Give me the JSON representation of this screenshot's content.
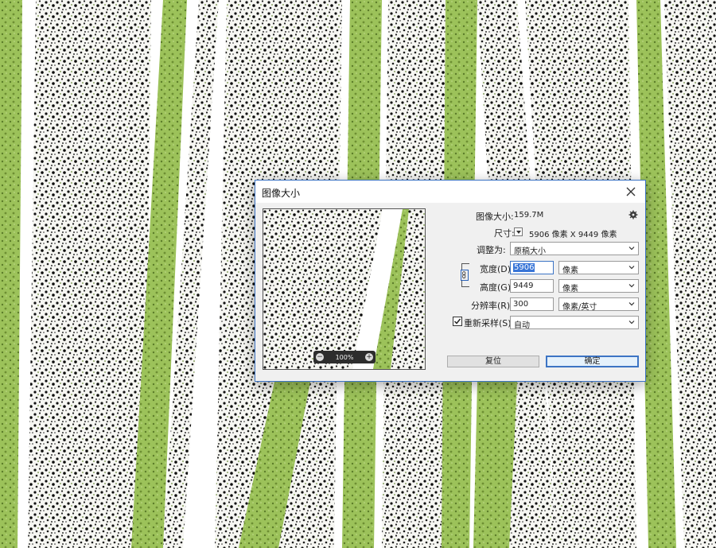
{
  "dialog": {
    "title": "图像大小",
    "image_size_label": "图像大小:",
    "image_size_value": "159.7M",
    "dimensions_label": "尺寸:",
    "dimensions_value": "5906 像素  X  9449 像素",
    "fit_to_label": "调整为:",
    "fit_to_value": "原稿大小",
    "width_label": "宽度(D):",
    "width_value": "5906",
    "width_unit": "像素",
    "height_label": "高度(G):",
    "height_value": "9449",
    "height_unit": "像素",
    "resolution_label": "分辨率(R):",
    "resolution_value": "300",
    "resolution_unit": "像素/英寸",
    "resample_label": "重新采样(S):",
    "resample_checked": true,
    "resample_value": "自动",
    "zoom_level": "100%",
    "reset_label": "复位",
    "ok_label": "确定"
  },
  "colors": {
    "texture_green": "#9cc25a",
    "accent_blue": "#3c74c4"
  }
}
